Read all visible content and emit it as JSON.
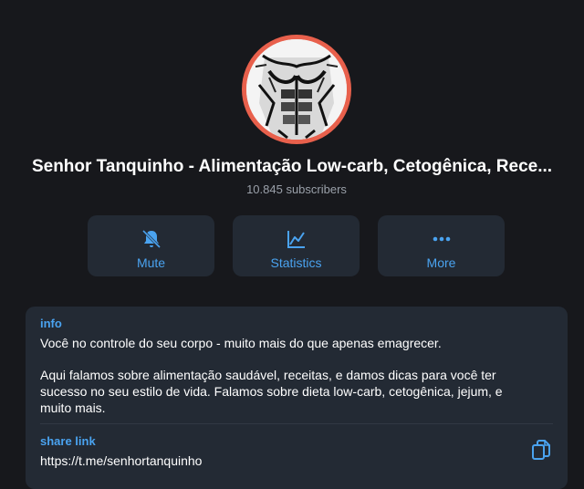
{
  "channel": {
    "title": "Senhor Tanquinho - Alimentação Low-carb, Cetogênica, Rece...",
    "subscribers": "10.845 subscribers",
    "avatar_icon": "abs-sketch-avatar"
  },
  "actions": [
    {
      "label": "Mute",
      "icon": "bell-muted-icon"
    },
    {
      "label": "Statistics",
      "icon": "chart-line-icon"
    },
    {
      "label": "More",
      "icon": "more-dots-icon"
    }
  ],
  "info": {
    "label": "info",
    "line1": "Você no controle do seu corpo - muito mais do que apenas emagrecer.",
    "line2": "Aqui falamos sobre alimentação saudável, receitas, e damos dicas para você ter",
    "line3": "sucesso no seu estilo de vida. Falamos sobre dieta low-carb, cetogênica, jejum, e",
    "line4": "muito mais."
  },
  "share": {
    "label": "share link",
    "url": "https://t.me/senhortanquinho"
  },
  "colors": {
    "background": "#17181c",
    "card": "#232a34",
    "accent": "#4aa3f0",
    "avatar_ring": "#e8604c"
  }
}
